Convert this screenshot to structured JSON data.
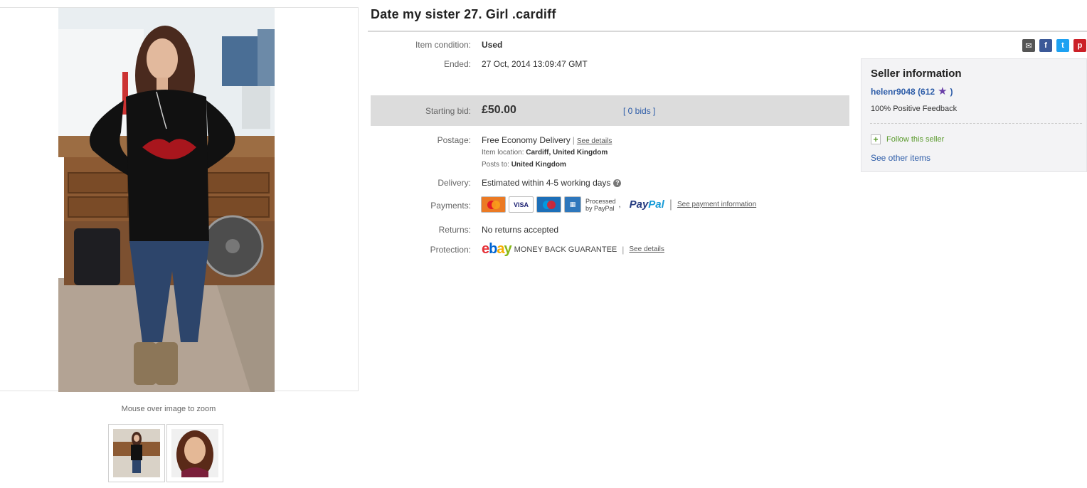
{
  "listing": {
    "title": "Date my sister 27. Girl .cardiff",
    "zoom_hint": "Mouse over image to zoom"
  },
  "details": {
    "condition": {
      "label": "Item condition:",
      "value": "Used"
    },
    "ended": {
      "label": "Ended:",
      "value": "27 Oct, 2014  13:09:47 GMT"
    },
    "bid": {
      "label": "Starting bid:",
      "price": "£50.00",
      "bids": "[ 0 bids ]"
    },
    "postage": {
      "label": "Postage:",
      "value": "Free  Economy Delivery",
      "link": "See details",
      "location_label": "Item location:",
      "location": "Cardiff, United Kingdom",
      "posts_to_label": "Posts to:",
      "posts_to": "United Kingdom"
    },
    "delivery": {
      "label": "Delivery:",
      "value": "Estimated within 4-5 working days"
    },
    "payments": {
      "label": "Payments:",
      "processed_line1": "Processed",
      "processed_line2": "by PayPal",
      "paypal_a": "Pay",
      "paypal_b": "Pal",
      "link": "See payment information"
    },
    "returns": {
      "label": "Returns:",
      "value": "No returns accepted"
    },
    "protection": {
      "label": "Protection:",
      "guarantee": "MONEY BACK GUARANTEE",
      "link": "See details"
    }
  },
  "seller": {
    "heading": "Seller information",
    "username": "helenr9048",
    "score": "(612",
    "close": ")",
    "feedback": "100% Positive Feedback",
    "follow": "Follow this seller",
    "other_items": "See other items"
  },
  "share_icons": [
    "email-icon",
    "facebook-icon",
    "twitter-icon",
    "pinterest-icon"
  ],
  "colors": {
    "link_blue": "#2d5ca8",
    "bid_bar": "#dcdcdc",
    "seller_box": "#f3f3f5",
    "follow_green": "#5a9a2c"
  }
}
